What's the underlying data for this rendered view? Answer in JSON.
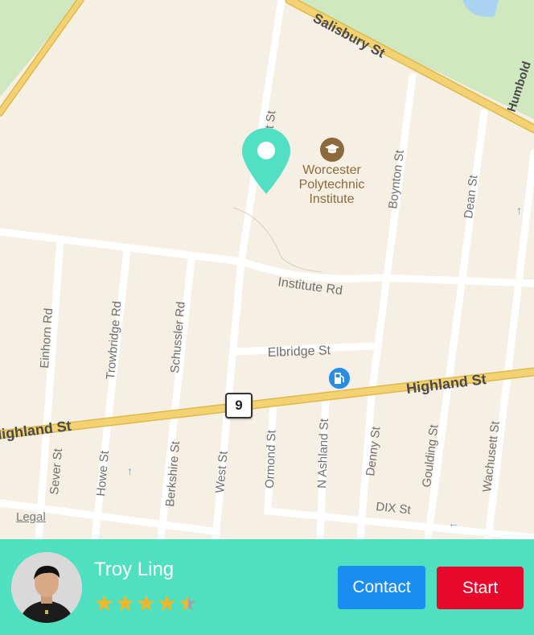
{
  "map": {
    "streets": {
      "salisbury": "Salisbury St",
      "humboldt": "Humbold",
      "west_top": "West St",
      "boynton": "Boynton St",
      "dean": "Dean St",
      "institute": "Institute Rd",
      "einhorn": "Einhorn Rd",
      "trowbridge": "Trowbridge Rd",
      "schussler": "Schussler Rd",
      "elbridge": "Elbridge St",
      "highland_left": "Highland St",
      "highland_right": "Highland St",
      "sever": "Sever St",
      "howe": "Howe St",
      "berkshire": "Berkshire St",
      "west_bottom": "West St",
      "ormond": "Ormond St",
      "n_ashland": "N Ashland St",
      "denny": "Denny St",
      "goulding": "Goulding St",
      "wachusett": "Wachusett St",
      "dix": "DIX St"
    },
    "poi_name": "Worcester\nPolytechnic\nInstitute",
    "poi_icon": "graduation-cap-icon",
    "fuel_icon": "fuel-station-icon",
    "pin_icon": "location-pin-icon",
    "route_number": "9",
    "legal": "Legal",
    "colors": {
      "land": "#f6efe4",
      "park": "#cfe8c0",
      "water": "#a9d3f0",
      "highway": "#f3d274",
      "pin": "#52e0c5"
    }
  },
  "driver": {
    "name": "Troy Ling",
    "rating": 4.5,
    "max_rating": 5,
    "avatar_icon": "driver-avatar"
  },
  "actions": {
    "contact_label": "Contact",
    "start_label": "Start",
    "contact_color": "#1a8df2",
    "start_color": "#e8082c"
  },
  "bar_color": "#4fe0bf"
}
